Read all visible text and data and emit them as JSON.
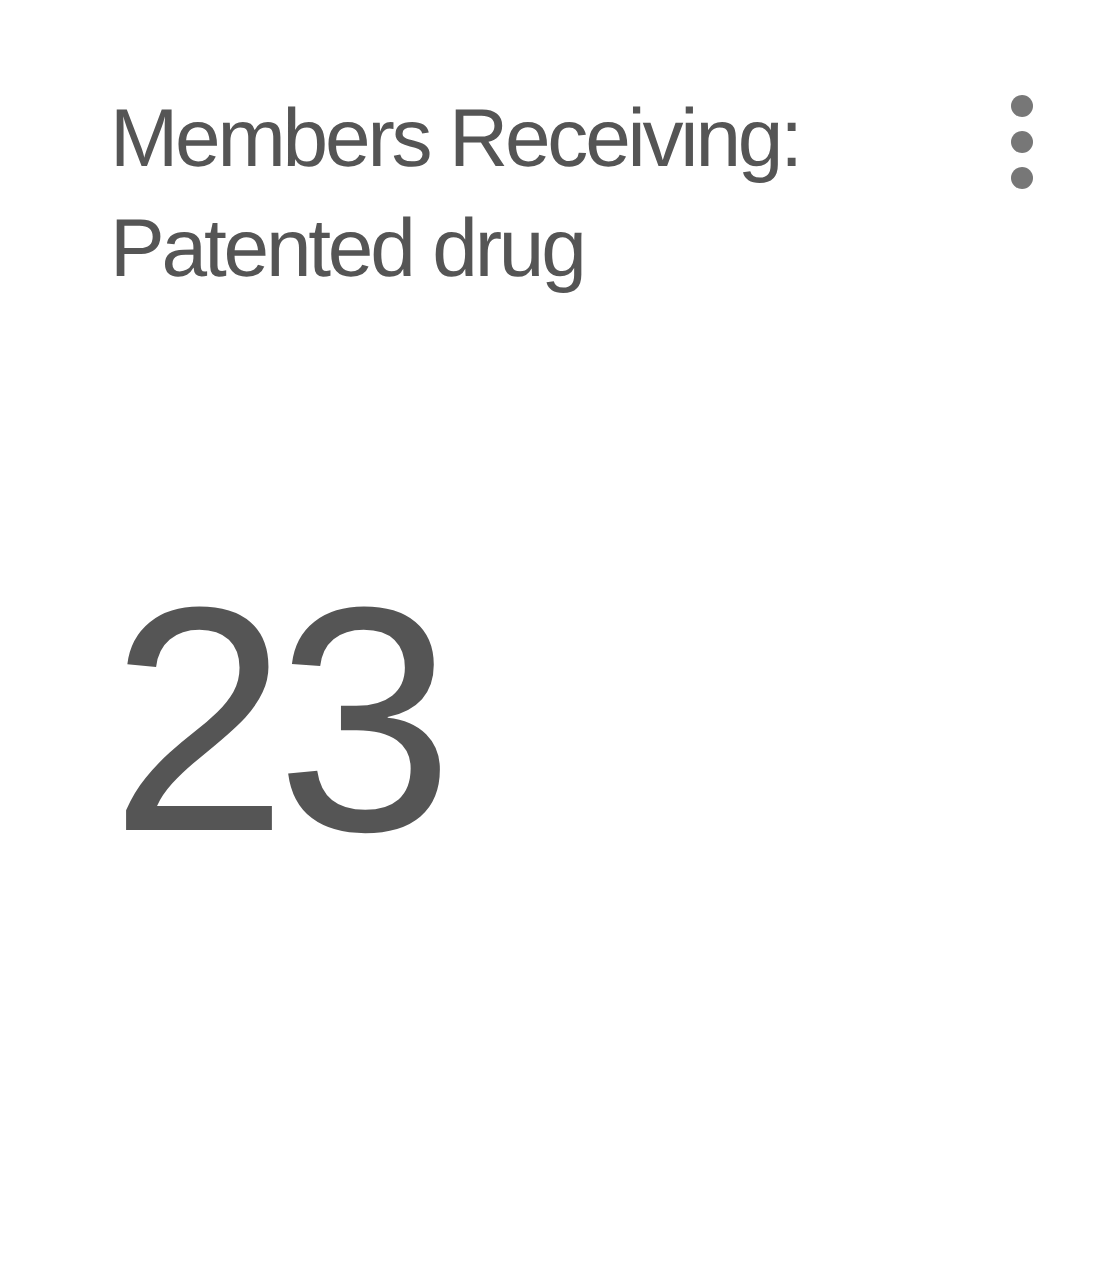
{
  "card": {
    "title": "Members Receiving: Patented drug",
    "value": "23"
  }
}
